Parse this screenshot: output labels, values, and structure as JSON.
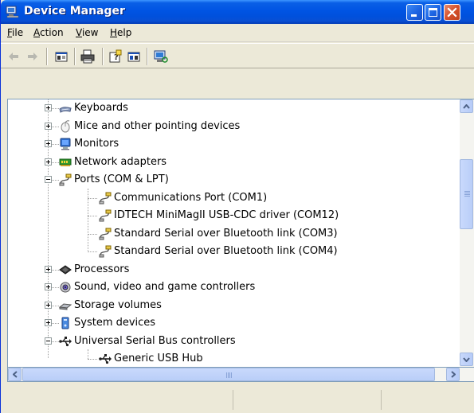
{
  "window": {
    "title": "Device Manager",
    "title_icon": "computer-management-icon",
    "buttons": [
      "minimize",
      "maximize",
      "close"
    ]
  },
  "menu": [
    {
      "accel": "F",
      "rest": "ile"
    },
    {
      "accel": "A",
      "rest": "ction"
    },
    {
      "accel": "V",
      "rest": "iew"
    },
    {
      "accel": "H",
      "rest": "elp"
    }
  ],
  "toolbar": {
    "buttons": [
      "back-arrow-icon",
      "forward-arrow-icon",
      "properties-icon",
      "print-icon",
      "help-icon",
      "update-driver-icon",
      "scan-hardware-icon"
    ]
  },
  "tree": {
    "nodes": [
      {
        "label": "Keyboards",
        "expander": "plus",
        "icon": "keyboard-icon",
        "level": 0
      },
      {
        "label": "Mice and other pointing devices",
        "expander": "plus",
        "icon": "mouse-icon",
        "level": 0
      },
      {
        "label": "Monitors",
        "expander": "plus",
        "icon": "monitor-icon",
        "level": 0
      },
      {
        "label": "Network adapters",
        "expander": "plus",
        "icon": "network-adapter-icon",
        "level": 0
      },
      {
        "label": "Ports (COM & LPT)",
        "expander": "minus",
        "icon": "port-icon",
        "level": 0
      },
      {
        "label": "Communications Port (COM1)",
        "expander": "none",
        "icon": "port-icon",
        "level": 1
      },
      {
        "label": "IDTECH MiniMagII USB-CDC driver (COM12)",
        "expander": "none",
        "icon": "port-icon",
        "level": 1
      },
      {
        "label": "Standard Serial over Bluetooth link (COM3)",
        "expander": "none",
        "icon": "port-icon",
        "level": 1
      },
      {
        "label": "Standard Serial over Bluetooth link (COM4)",
        "expander": "none",
        "icon": "port-icon",
        "level": 1
      },
      {
        "label": "Processors",
        "expander": "plus",
        "icon": "processor-icon",
        "level": 0
      },
      {
        "label": "Sound, video and game controllers",
        "expander": "plus",
        "icon": "sound-icon",
        "level": 0
      },
      {
        "label": "Storage volumes",
        "expander": "plus",
        "icon": "storage-icon",
        "level": 0
      },
      {
        "label": "System devices",
        "expander": "plus",
        "icon": "system-devices-icon",
        "level": 0
      },
      {
        "label": "Universal Serial Bus controllers",
        "expander": "minus",
        "icon": "usb-icon",
        "level": 0
      },
      {
        "label": "Generic USB Hub",
        "expander": "none",
        "icon": "usb-icon",
        "level": 1
      }
    ]
  },
  "colors": {
    "titlebar": "#0054e3",
    "close_button": "#d6512b",
    "chrome": "#ece9d8",
    "tree_border": "#7f9db9"
  }
}
